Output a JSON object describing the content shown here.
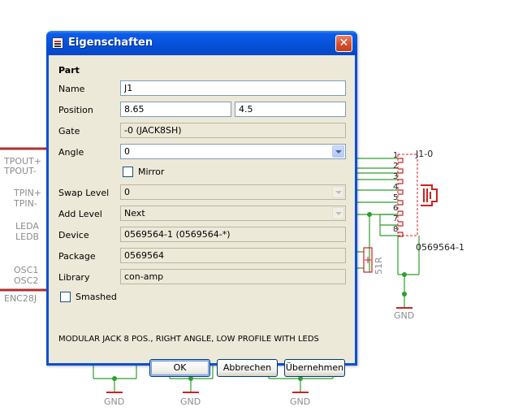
{
  "dialog": {
    "title": "Eigenschaften",
    "close_glyph": "✕",
    "section_label": "Part",
    "name_label": "Name",
    "name_value": "J1",
    "position_label": "Position",
    "position_x": "8.65",
    "position_y": "4.5",
    "gate_label": "Gate",
    "gate_value": "-0 (JACK8SH)",
    "angle_label": "Angle",
    "angle_value": "0",
    "mirror_label": "Mirror",
    "swap_label": "Swap Level",
    "swap_value": "0",
    "add_label": "Add Level",
    "add_value": "Next",
    "device_label": "Device",
    "device_value": "0569564-1 (0569564-*)",
    "package_label": "Package",
    "package_value": "0569564",
    "library_label": "Library",
    "library_value": "con-amp",
    "smashed_label": "Smashed",
    "description": "MODULAR JACK 8 POS., RIGHT ANGLE, LOW PROFILE WITH LEDS",
    "ok_label": "OK",
    "cancel_label": "Abbrechen",
    "apply_label": "Übernehmen"
  },
  "schematic": {
    "left_labels": [
      "TPOUT+",
      "TPOUT-",
      "TPIN+",
      "TPIN-",
      "LEDA",
      "LEDB",
      "OSC1",
      "OSC2",
      "ENC28J"
    ],
    "part_name": "J1-0",
    "part_value": "0569564-1",
    "pin_numbers": [
      "1",
      "2",
      "3",
      "4",
      "5",
      "6",
      "7",
      "8"
    ],
    "resistor_label": "51R",
    "gnd_labels": [
      "GND",
      "GND",
      "GND",
      "GND"
    ],
    "colors": {
      "wire": "#2f9e2f",
      "part": "#cc2222",
      "bus": "#b03030",
      "text": "#8c8c8c"
    }
  }
}
